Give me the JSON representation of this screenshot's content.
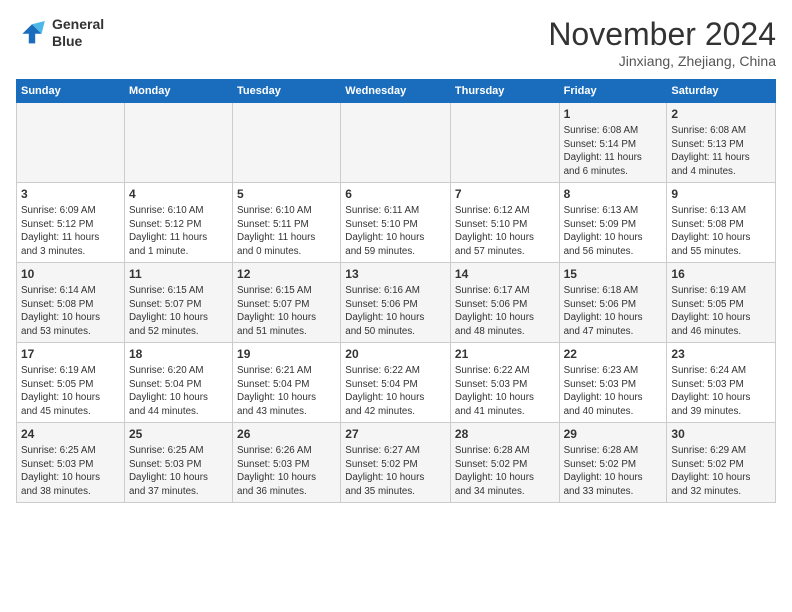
{
  "header": {
    "logo": {
      "line1": "General",
      "line2": "Blue"
    },
    "title": "November 2024",
    "location": "Jinxiang, Zhejiang, China"
  },
  "weekdays": [
    "Sunday",
    "Monday",
    "Tuesday",
    "Wednesday",
    "Thursday",
    "Friday",
    "Saturday"
  ],
  "weeks": [
    [
      {
        "day": "",
        "info": ""
      },
      {
        "day": "",
        "info": ""
      },
      {
        "day": "",
        "info": ""
      },
      {
        "day": "",
        "info": ""
      },
      {
        "day": "",
        "info": ""
      },
      {
        "day": "1",
        "info": "Sunrise: 6:08 AM\nSunset: 5:14 PM\nDaylight: 11 hours\nand 6 minutes."
      },
      {
        "day": "2",
        "info": "Sunrise: 6:08 AM\nSunset: 5:13 PM\nDaylight: 11 hours\nand 4 minutes."
      }
    ],
    [
      {
        "day": "3",
        "info": "Sunrise: 6:09 AM\nSunset: 5:12 PM\nDaylight: 11 hours\nand 3 minutes."
      },
      {
        "day": "4",
        "info": "Sunrise: 6:10 AM\nSunset: 5:12 PM\nDaylight: 11 hours\nand 1 minute."
      },
      {
        "day": "5",
        "info": "Sunrise: 6:10 AM\nSunset: 5:11 PM\nDaylight: 11 hours\nand 0 minutes."
      },
      {
        "day": "6",
        "info": "Sunrise: 6:11 AM\nSunset: 5:10 PM\nDaylight: 10 hours\nand 59 minutes."
      },
      {
        "day": "7",
        "info": "Sunrise: 6:12 AM\nSunset: 5:10 PM\nDaylight: 10 hours\nand 57 minutes."
      },
      {
        "day": "8",
        "info": "Sunrise: 6:13 AM\nSunset: 5:09 PM\nDaylight: 10 hours\nand 56 minutes."
      },
      {
        "day": "9",
        "info": "Sunrise: 6:13 AM\nSunset: 5:08 PM\nDaylight: 10 hours\nand 55 minutes."
      }
    ],
    [
      {
        "day": "10",
        "info": "Sunrise: 6:14 AM\nSunset: 5:08 PM\nDaylight: 10 hours\nand 53 minutes."
      },
      {
        "day": "11",
        "info": "Sunrise: 6:15 AM\nSunset: 5:07 PM\nDaylight: 10 hours\nand 52 minutes."
      },
      {
        "day": "12",
        "info": "Sunrise: 6:15 AM\nSunset: 5:07 PM\nDaylight: 10 hours\nand 51 minutes."
      },
      {
        "day": "13",
        "info": "Sunrise: 6:16 AM\nSunset: 5:06 PM\nDaylight: 10 hours\nand 50 minutes."
      },
      {
        "day": "14",
        "info": "Sunrise: 6:17 AM\nSunset: 5:06 PM\nDaylight: 10 hours\nand 48 minutes."
      },
      {
        "day": "15",
        "info": "Sunrise: 6:18 AM\nSunset: 5:06 PM\nDaylight: 10 hours\nand 47 minutes."
      },
      {
        "day": "16",
        "info": "Sunrise: 6:19 AM\nSunset: 5:05 PM\nDaylight: 10 hours\nand 46 minutes."
      }
    ],
    [
      {
        "day": "17",
        "info": "Sunrise: 6:19 AM\nSunset: 5:05 PM\nDaylight: 10 hours\nand 45 minutes."
      },
      {
        "day": "18",
        "info": "Sunrise: 6:20 AM\nSunset: 5:04 PM\nDaylight: 10 hours\nand 44 minutes."
      },
      {
        "day": "19",
        "info": "Sunrise: 6:21 AM\nSunset: 5:04 PM\nDaylight: 10 hours\nand 43 minutes."
      },
      {
        "day": "20",
        "info": "Sunrise: 6:22 AM\nSunset: 5:04 PM\nDaylight: 10 hours\nand 42 minutes."
      },
      {
        "day": "21",
        "info": "Sunrise: 6:22 AM\nSunset: 5:03 PM\nDaylight: 10 hours\nand 41 minutes."
      },
      {
        "day": "22",
        "info": "Sunrise: 6:23 AM\nSunset: 5:03 PM\nDaylight: 10 hours\nand 40 minutes."
      },
      {
        "day": "23",
        "info": "Sunrise: 6:24 AM\nSunset: 5:03 PM\nDaylight: 10 hours\nand 39 minutes."
      }
    ],
    [
      {
        "day": "24",
        "info": "Sunrise: 6:25 AM\nSunset: 5:03 PM\nDaylight: 10 hours\nand 38 minutes."
      },
      {
        "day": "25",
        "info": "Sunrise: 6:25 AM\nSunset: 5:03 PM\nDaylight: 10 hours\nand 37 minutes."
      },
      {
        "day": "26",
        "info": "Sunrise: 6:26 AM\nSunset: 5:03 PM\nDaylight: 10 hours\nand 36 minutes."
      },
      {
        "day": "27",
        "info": "Sunrise: 6:27 AM\nSunset: 5:02 PM\nDaylight: 10 hours\nand 35 minutes."
      },
      {
        "day": "28",
        "info": "Sunrise: 6:28 AM\nSunset: 5:02 PM\nDaylight: 10 hours\nand 34 minutes."
      },
      {
        "day": "29",
        "info": "Sunrise: 6:28 AM\nSunset: 5:02 PM\nDaylight: 10 hours\nand 33 minutes."
      },
      {
        "day": "30",
        "info": "Sunrise: 6:29 AM\nSunset: 5:02 PM\nDaylight: 10 hours\nand 32 minutes."
      }
    ]
  ]
}
